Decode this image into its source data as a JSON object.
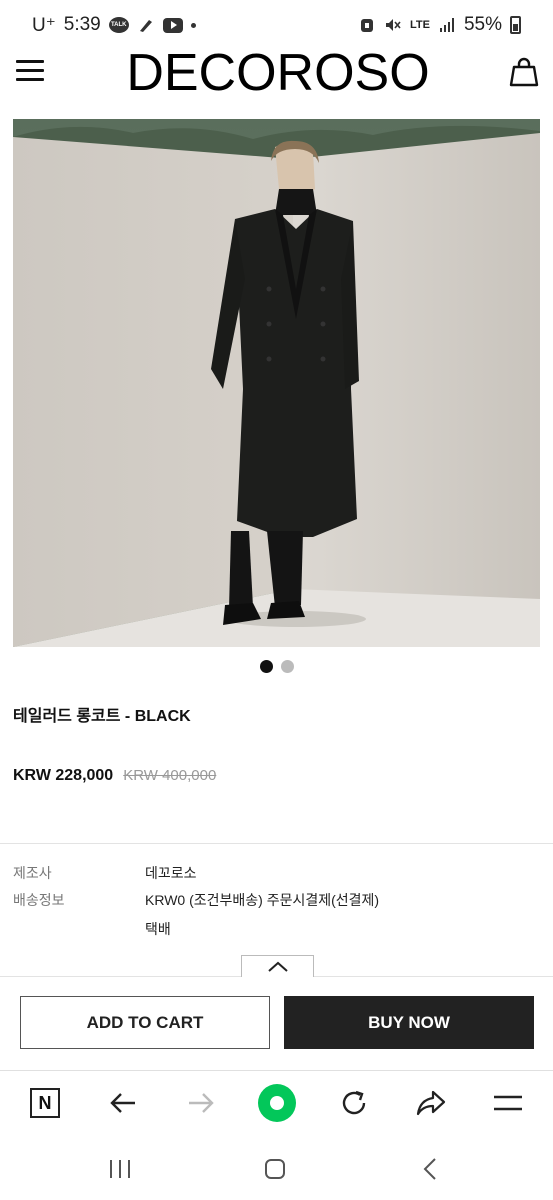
{
  "status_bar": {
    "carrier": "U⁺",
    "time": "5:39",
    "talk_label": "TALK",
    "network": "LTE",
    "battery": "55%"
  },
  "header": {
    "logo": "DECOROSO"
  },
  "gallery": {
    "active_index": 0,
    "count": 2
  },
  "product": {
    "title": "테일러드 롱코트 - BLACK",
    "sale_price": "KRW 228,000",
    "original_price": "KRW 400,000"
  },
  "info": {
    "manufacturer_label": "제조사",
    "manufacturer_value": "데꼬로소",
    "shipping_label": "배송정보",
    "shipping_value": "KRW0 (조건부배송) 주문시결제(선결제)",
    "shipping_method": "택배"
  },
  "actions": {
    "add_to_cart": "ADD TO CART",
    "buy_now": "BUY NOW"
  },
  "browser_toolbar": {
    "home_label": "N"
  },
  "colors": {
    "buy_button_bg": "#222222",
    "browser_accent": "#03c75a"
  }
}
